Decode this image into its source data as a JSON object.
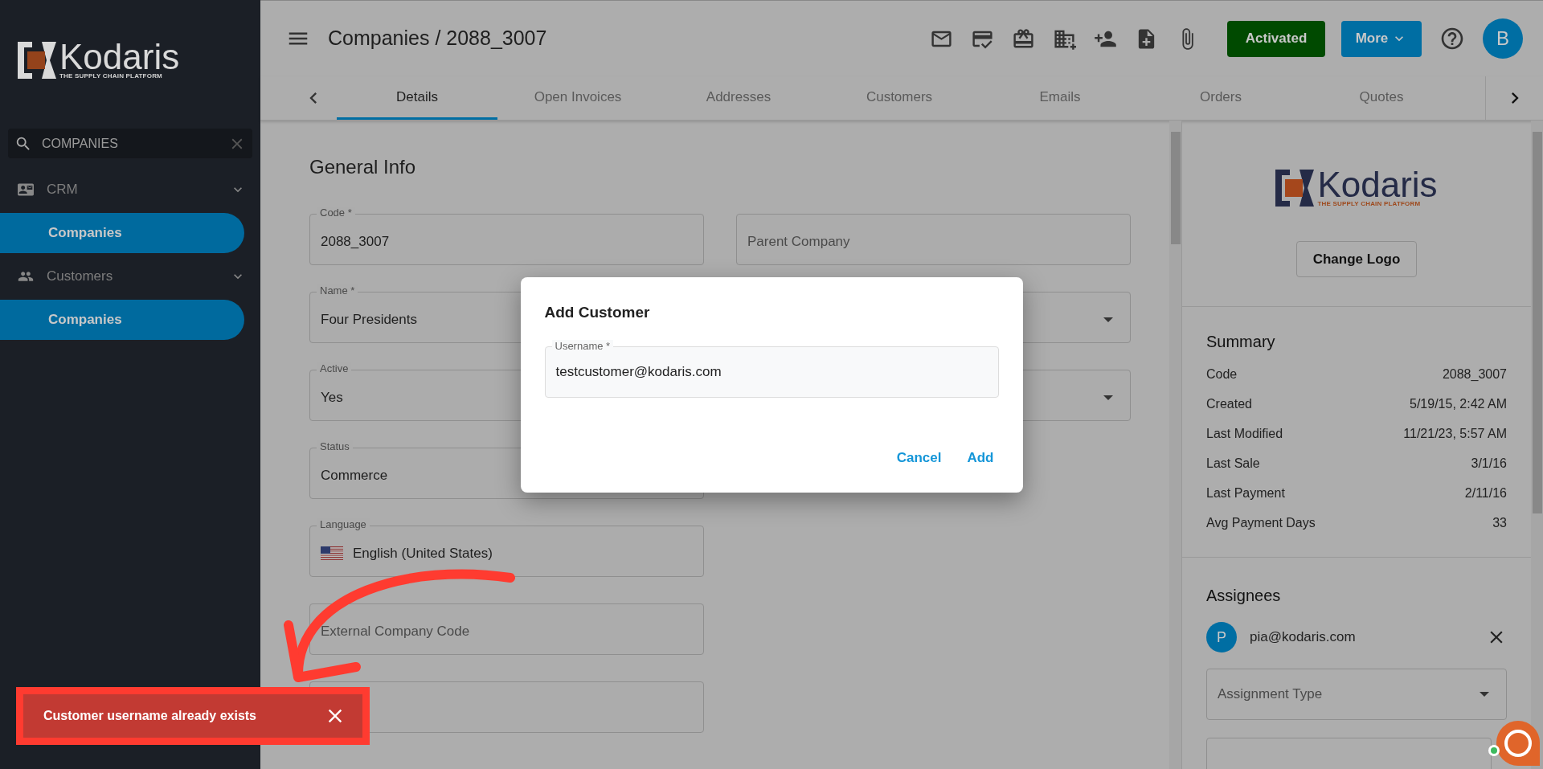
{
  "sidebar": {
    "logo": {
      "name": "Kodaris",
      "tagline": "THE SUPPLY CHAIN PLATFORM"
    },
    "search": {
      "value": "COMPANIES"
    },
    "groups": [
      {
        "label": "CRM",
        "kind": "crm",
        "expanded": true,
        "items": [
          {
            "label": "Companies",
            "selected": true
          }
        ]
      },
      {
        "label": "Customers",
        "kind": "customers",
        "expanded": true,
        "items": [
          {
            "label": "Companies",
            "selected": true
          }
        ]
      }
    ]
  },
  "header": {
    "title": "Companies / 2088_3007",
    "status_button": "Activated",
    "more_button": "More",
    "avatar": "B"
  },
  "tabs": [
    {
      "label": "Details",
      "selected": true
    },
    {
      "label": "Open Invoices",
      "selected": false
    },
    {
      "label": "Addresses",
      "selected": false
    },
    {
      "label": "Customers",
      "selected": false
    },
    {
      "label": "Emails",
      "selected": false
    },
    {
      "label": "Orders",
      "selected": false
    },
    {
      "label": "Quotes",
      "selected": false
    }
  ],
  "general_info": {
    "title": "General Info",
    "left_fields": [
      {
        "kind": "text",
        "label": "Code *",
        "value": "2088_3007"
      },
      {
        "kind": "text",
        "label": "Name *",
        "value": "Four Presidents"
      },
      {
        "kind": "text",
        "label": "Active",
        "value": "Yes"
      },
      {
        "kind": "text",
        "label": "Status",
        "value": "Commerce"
      },
      {
        "kind": "language",
        "label": "Language",
        "value": "English (United States)"
      },
      {
        "kind": "text",
        "placeholder": "External Company Code"
      },
      {
        "kind": "text"
      }
    ],
    "right_fields": [
      {
        "kind": "text",
        "placeholder": "Parent Company"
      },
      {
        "kind": "select"
      },
      {
        "kind": "select"
      }
    ]
  },
  "company_panel": {
    "logo": {
      "name": "Kodaris",
      "tagline": "THE SUPPLY CHAIN PLATFORM"
    },
    "change_logo_button": "Change Logo",
    "summary": {
      "title": "Summary",
      "rows": [
        {
          "label": "Code",
          "value": "2088_3007"
        },
        {
          "label": "Created",
          "value": "5/19/15, 2:42 AM"
        },
        {
          "label": "Last Modified",
          "value": "11/21/23, 5:57 AM"
        },
        {
          "label": "Last Sale",
          "value": "3/1/16"
        },
        {
          "label": "Last Payment",
          "value": "2/11/16"
        },
        {
          "label": "Avg Payment Days",
          "value": "33"
        }
      ]
    },
    "assignees": {
      "title": "Assignees",
      "people": [
        {
          "initial": "P",
          "email": "pia@kodaris.com"
        }
      ],
      "assignment_type": {
        "placeholder": "Assignment Type"
      }
    }
  },
  "dialog": {
    "title": "Add Customer",
    "field": {
      "label": "Username *",
      "value": "testcustomer@kodaris.com"
    },
    "buttons": [
      "Cancel",
      "Add"
    ]
  },
  "toast": {
    "message": "Customer username already exists"
  }
}
